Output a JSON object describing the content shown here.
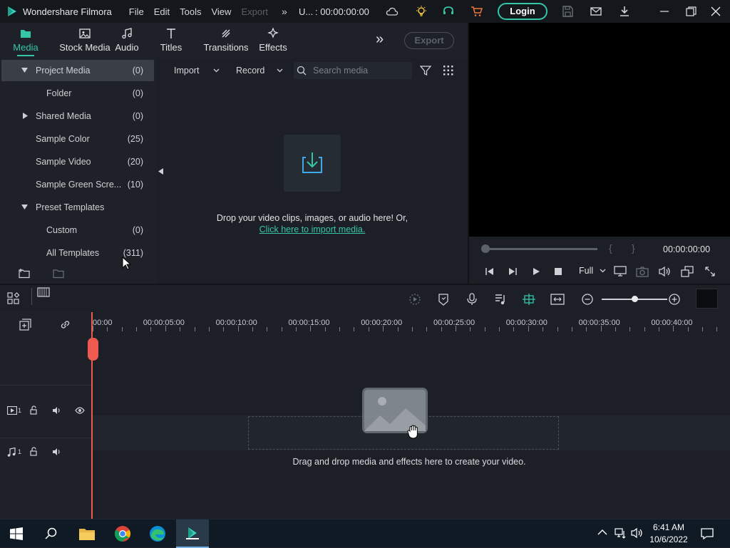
{
  "app": {
    "title": "Wondershare Filmora"
  },
  "menu": {
    "file": "File",
    "edit": "Edit",
    "tools": "Tools",
    "view": "View",
    "export": "Export"
  },
  "project": {
    "name": "U...",
    "timecode": ": 00:00:00:00"
  },
  "header": {
    "login_label": "Login"
  },
  "tabs": [
    {
      "label": "Media",
      "icon": "folder-icon",
      "active": true
    },
    {
      "label": "Stock Media",
      "icon": "image-icon"
    },
    {
      "label": "Audio",
      "icon": "music-note-icon"
    },
    {
      "label": "Titles",
      "icon": "text-icon"
    },
    {
      "label": "Transitions",
      "icon": "transitions-icon"
    },
    {
      "label": "Effects",
      "icon": "effects-icon"
    }
  ],
  "export_label": "Export",
  "tree": [
    {
      "label": "Project Media",
      "count": "(0)"
    },
    {
      "label": "Folder",
      "count": "(0)"
    },
    {
      "label": "Shared Media",
      "count": "(0)"
    },
    {
      "label": "Sample Color",
      "count": "(25)"
    },
    {
      "label": "Sample Video",
      "count": "(20)"
    },
    {
      "label": "Sample Green Scre...",
      "count": "(10)"
    },
    {
      "label": "Preset Templates",
      "count": ""
    },
    {
      "label": "Custom",
      "count": "(0)"
    },
    {
      "label": "All Templates",
      "count": "(311)"
    }
  ],
  "media": {
    "import_label": "Import",
    "record_label": "Record",
    "search_placeholder": "Search media",
    "drop_text": "Drop your video clips, images, or audio here! Or,",
    "import_link": "Click here to import media."
  },
  "preview": {
    "timecode": "00:00:00:00",
    "quality": "Full",
    "bracket_in": "{",
    "bracket_out": "}"
  },
  "timeline": {
    "ruler": [
      "00:00",
      "00:00:05:00",
      "00:00:10:00",
      "00:00:15:00",
      "00:00:20:00",
      "00:00:25:00",
      "00:00:30:00",
      "00:00:35:00",
      "00:00:40:00"
    ],
    "video_track": "1",
    "audio_track": "1",
    "drop_message": "Drag and drop media and effects here to create your video."
  },
  "taskbar": {
    "time": "6:41 AM",
    "date": "10/6/2022"
  },
  "colors": {
    "accent": "#35c5a7",
    "playhead": "#ee5a4f"
  }
}
